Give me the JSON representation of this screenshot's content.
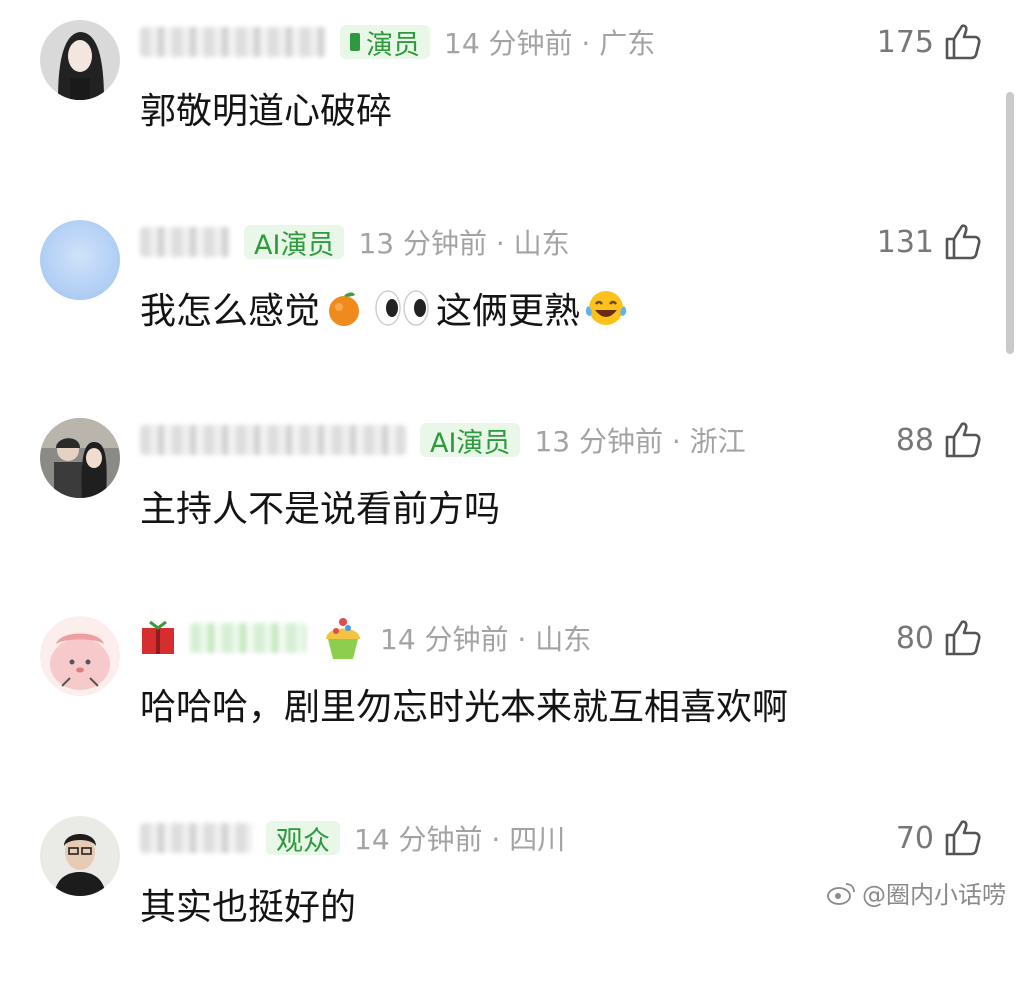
{
  "comments": [
    {
      "badge": "演员",
      "time": "14 分钟前 · 广东",
      "likes": "175",
      "text": "郭敬明道心破碎",
      "avatar": "woman-long-hair-avatar"
    },
    {
      "badge": "AI演员",
      "time": "13 分钟前 · 山东",
      "likes": "131",
      "text_parts": [
        "我怎么感觉",
        "这俩更熟"
      ],
      "emojis": [
        "tangerine-emoji",
        "eyes-emoji",
        "joy-emoji"
      ],
      "avatar": "light-blue-avatar"
    },
    {
      "badge": "AI演员",
      "time": "13 分钟前 · 浙江",
      "likes": "88",
      "text": "主持人不是说看前方吗",
      "avatar": "couple-photo-avatar"
    },
    {
      "badge": "",
      "time": "14 分钟前 · 山东",
      "likes": "80",
      "text": "哈哈哈，剧里勿忘时光本来就互相喜欢啊",
      "avatar": "pink-cartoon-avatar"
    },
    {
      "badge": "观众",
      "time": "14 分钟前 · 四川",
      "likes": "70",
      "text": "其实也挺好的",
      "avatar": "man-glasses-avatar"
    }
  ],
  "watermark": "@圈内小话唠",
  "colors": {
    "badge_bg": "#e9f7e8",
    "badge_text": "#2e9a3d",
    "meta_text": "#a3a3a3"
  }
}
